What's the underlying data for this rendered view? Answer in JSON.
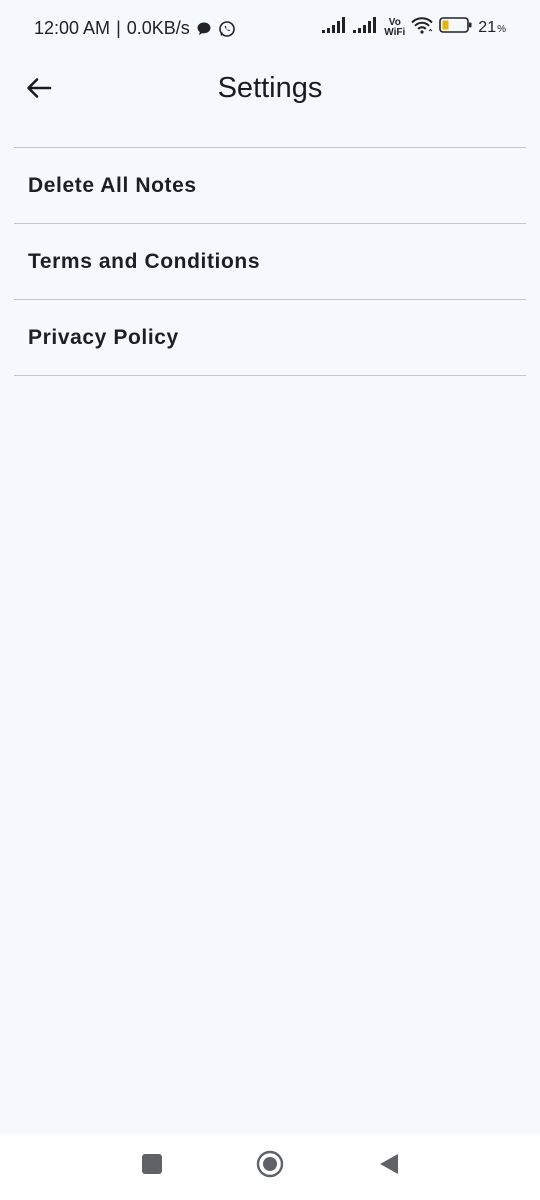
{
  "status_bar": {
    "time": "12:00 AM",
    "speed": "0.0KB/s",
    "vowifi_top": "Vo",
    "vowifi_bottom": "WiFi",
    "battery_level": "21",
    "battery_unit": "%"
  },
  "app_bar": {
    "title": "Settings",
    "back_icon": "arrow-back-icon"
  },
  "settings": {
    "items": [
      {
        "label": "Delete All Notes"
      },
      {
        "label": "Terms and Conditions"
      },
      {
        "label": "Privacy Policy"
      }
    ]
  },
  "nav_bar": {
    "icons": [
      "recents-square-icon",
      "home-circle-icon",
      "back-triangle-icon"
    ]
  },
  "colors": {
    "background": "#f5f9fd",
    "divider": "#c6c6c9",
    "text": "#1b1b1f",
    "nav_icon": "#5f6368"
  }
}
